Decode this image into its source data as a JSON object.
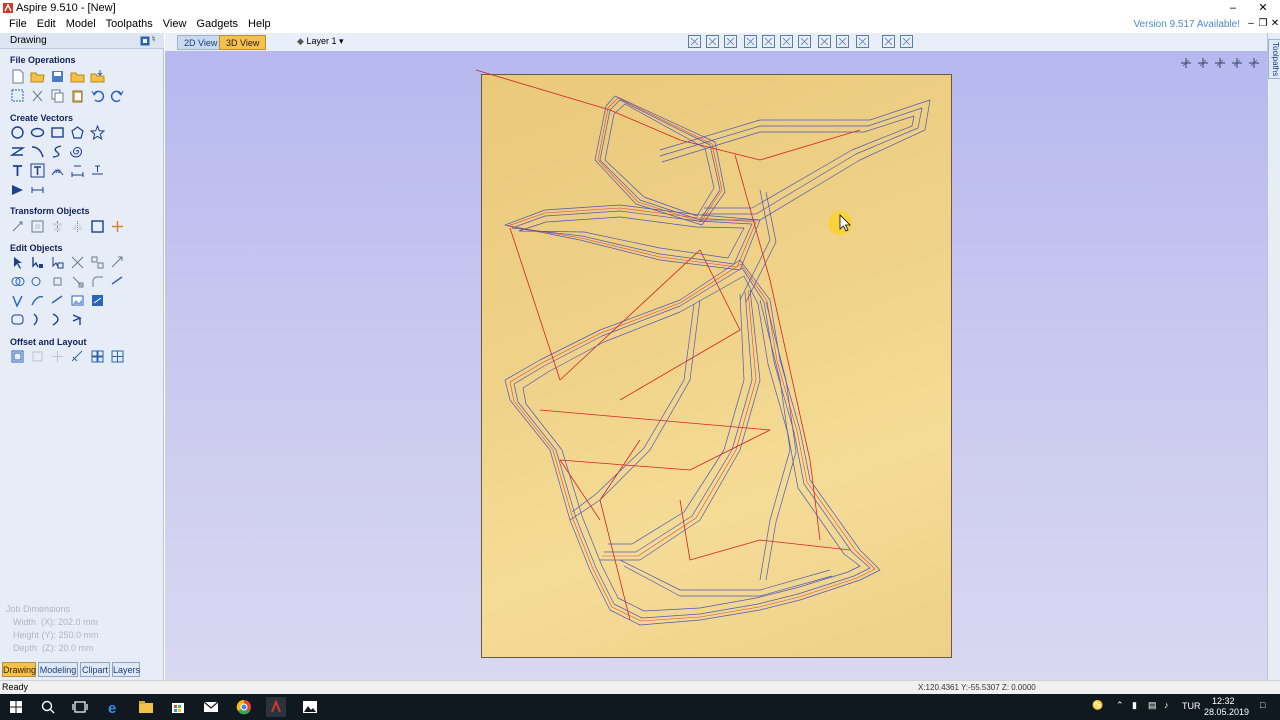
{
  "window": {
    "title": "Aspire 9.510 - [New]",
    "version_notice": "Version 9.517 Available!"
  },
  "menu": [
    "File",
    "Edit",
    "Model",
    "Toolpaths",
    "View",
    "Gadgets",
    "Help"
  ],
  "left_panel": {
    "header": "Drawing",
    "sections": [
      {
        "title": "File Operations"
      },
      {
        "title": "Create Vectors"
      },
      {
        "title": "Transform Objects"
      },
      {
        "title": "Edit Objects"
      },
      {
        "title": "Offset and Layout"
      }
    ],
    "job_dimensions": {
      "title": "Job Dimensions",
      "width": "Width  (X): 202.0 mm",
      "height": "Height (Y): 250.0 mm",
      "depth": "Depth  (Z): 20.0 mm"
    },
    "bottom_tabs": [
      "Drawing",
      "Modeling",
      "Clipart",
      "Layers"
    ]
  },
  "view_tabs": [
    "2D View",
    "3D View"
  ],
  "active_view_tab": "3D View",
  "layer_dropdown": "Layer 1",
  "right_strip_label": "Toolpaths",
  "status": {
    "text": "Ready",
    "coords": "X:120.4361 Y:-55.5307 Z: 0.0000"
  },
  "taskbar": {
    "language": "TUR",
    "time": "12:32",
    "date": "28.05.2019"
  },
  "colors": {
    "toolpath_blue": "#4d58b8",
    "toolpath_red": "#d81f26",
    "accent_tab": "#f4c24a"
  }
}
